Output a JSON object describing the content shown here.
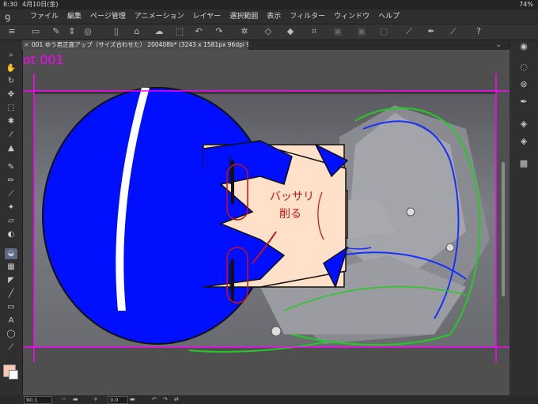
{
  "status": {
    "time": "8:30",
    "date": "4月10日(金)",
    "battery": "74%"
  },
  "menu": [
    "ファイル",
    "編集",
    "ページ管理",
    "アニメーション",
    "レイヤー",
    "選択範囲",
    "表示",
    "フィルター",
    "ウィンドウ",
    "ヘルプ"
  ],
  "tab": {
    "close": "×",
    "title": "001 ゆう君正面アップ（サイズ合わせた） 200408b* (3243 x 1581px 96dpi 90.1%)"
  },
  "canvas": {
    "shot_label": "ot 001",
    "annotation_line1": "バッサリ",
    "annotation_line2": "削る"
  },
  "bottom": {
    "zoom": "90.1",
    "rotation": "0.0"
  },
  "colors": {
    "main": "#f6c9b0",
    "sub": "#ffffff",
    "guide": "#ff00ff",
    "hair": "#0010ff"
  }
}
